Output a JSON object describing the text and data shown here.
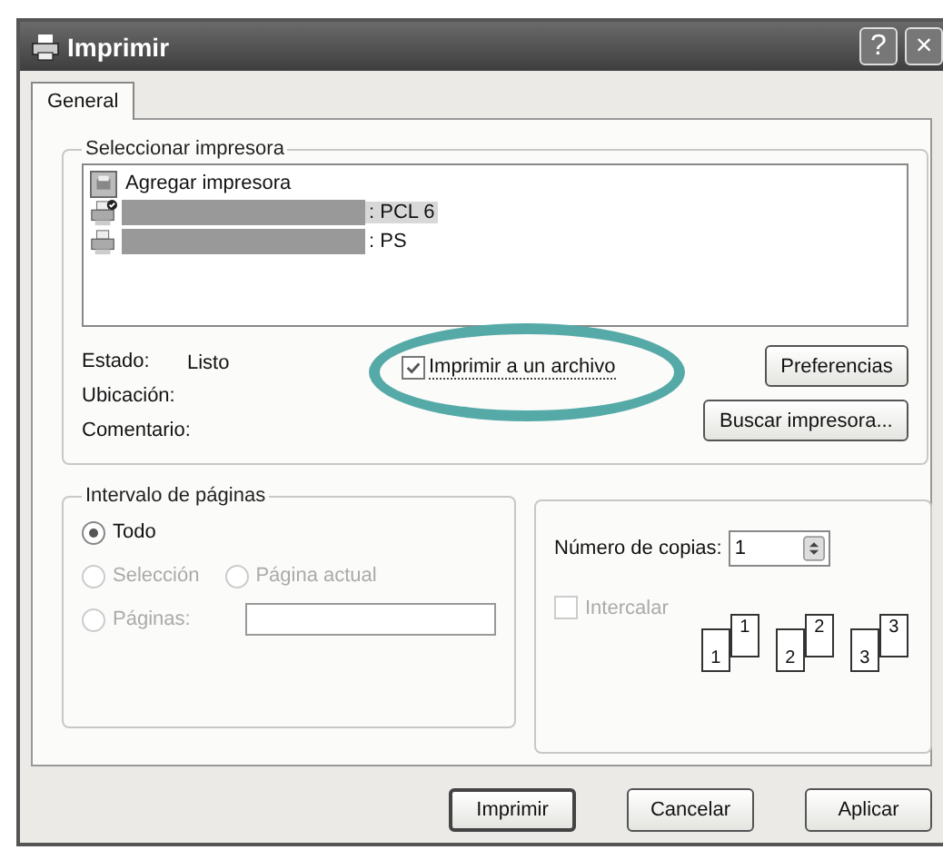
{
  "window": {
    "title": "Imprimir",
    "help_button": "?",
    "close_button": "×"
  },
  "tabs": [
    {
      "label": "General",
      "selected": true
    }
  ],
  "printer_group": {
    "title": "Seleccionar impresora",
    "printers": [
      {
        "kind": "add",
        "name": "Agregar impresora",
        "selected": false
      },
      {
        "kind": "printer",
        "name": ": PCL 6",
        "default": true,
        "selected": true
      },
      {
        "kind": "printer",
        "name": ": PS",
        "default": false,
        "selected": false
      }
    ],
    "status": [
      {
        "label": "Estado:",
        "value": "Listo"
      },
      {
        "label": "Ubicación:"
      },
      {
        "label": "Comentario:"
      }
    ],
    "print_to_file": {
      "label": "Imprimir a un archivo",
      "checked": true
    },
    "preferences_button": "Preferencias",
    "find_button": "Buscar impresora..."
  },
  "range_group": {
    "title": "Intervalo de páginas",
    "options": [
      {
        "label": "Todo",
        "selected": true,
        "disabled": false
      },
      {
        "label": "Selección",
        "selected": false,
        "disabled": true
      },
      {
        "label": "Página actual",
        "selected": false,
        "disabled": true
      },
      {
        "label": "Páginas:",
        "selected": false,
        "disabled": true
      }
    ]
  },
  "copies": {
    "label": "Número de copias:",
    "value": "1",
    "collate": {
      "label": "Intercalar",
      "checked": false,
      "disabled": true
    },
    "collate_pages": [
      {
        "back": "1",
        "front": "1"
      },
      {
        "back": "2",
        "front": "2"
      },
      {
        "back": "3",
        "front": "3"
      }
    ]
  },
  "buttons": [
    "Imprimir",
    "Cancelar",
    "Aplicar"
  ]
}
